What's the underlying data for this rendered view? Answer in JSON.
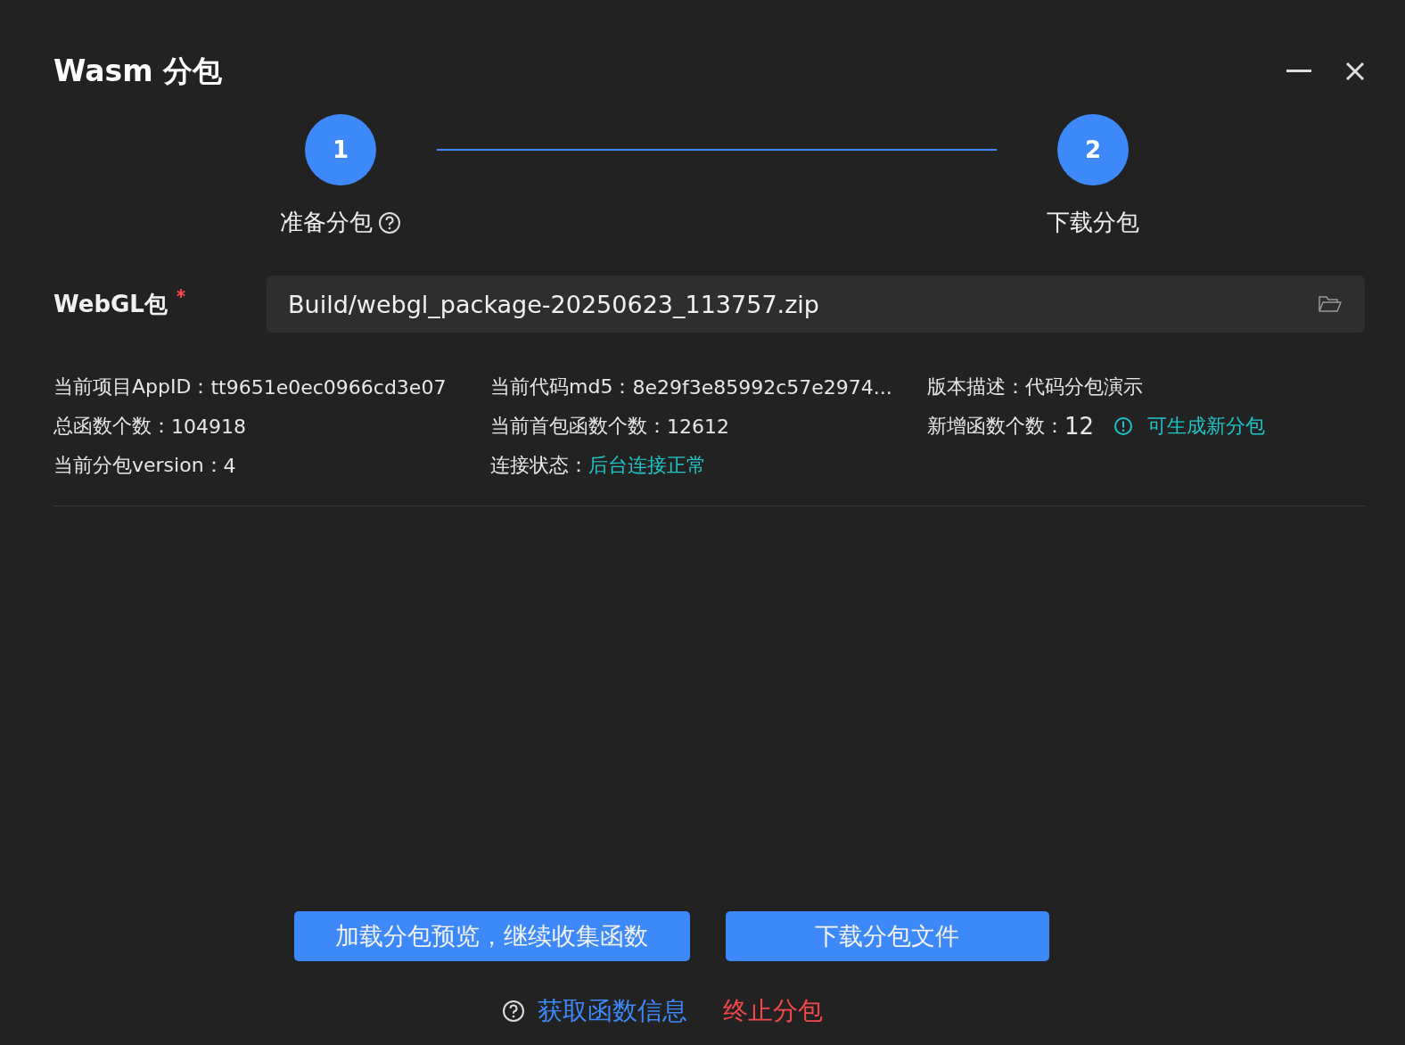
{
  "window": {
    "title": "Wasm 分包"
  },
  "steps": [
    {
      "number": "1",
      "label": "准备分包",
      "help": true
    },
    {
      "number": "2",
      "label": "下载分包",
      "help": false
    }
  ],
  "package_field": {
    "label": "WebGL包",
    "required": true,
    "value": "Build/webgl_package-20250623_113757.zip"
  },
  "info": [
    {
      "label": "当前项目AppID：",
      "value": "tt9651e0ec0966cd3e07",
      "kind": "normal"
    },
    {
      "label": "当前代码md5：",
      "value": "8e29f3e85992c57e2974...",
      "kind": "normal"
    },
    {
      "label": "版本描述：",
      "value": "代码分包演示",
      "kind": "normal"
    },
    {
      "label": "总函数个数：",
      "value": "104918",
      "kind": "normal"
    },
    {
      "label": "当前首包函数个数：",
      "value": "12612",
      "kind": "normal"
    },
    {
      "label": "新增函数个数：",
      "value": "12",
      "kind": "large",
      "note": "可生成新分包"
    },
    {
      "label": "当前分包version：",
      "value": "4",
      "kind": "normal"
    },
    {
      "label": "连接状态：",
      "value": "后台连接正常",
      "kind": "link"
    }
  ],
  "buttons": [
    "加载分包预览，继续收集函数",
    "下载分包文件"
  ],
  "footer_links": [
    {
      "label": "获取函数信息",
      "kind": "help"
    },
    {
      "label": "终止分包",
      "kind": "danger"
    }
  ]
}
